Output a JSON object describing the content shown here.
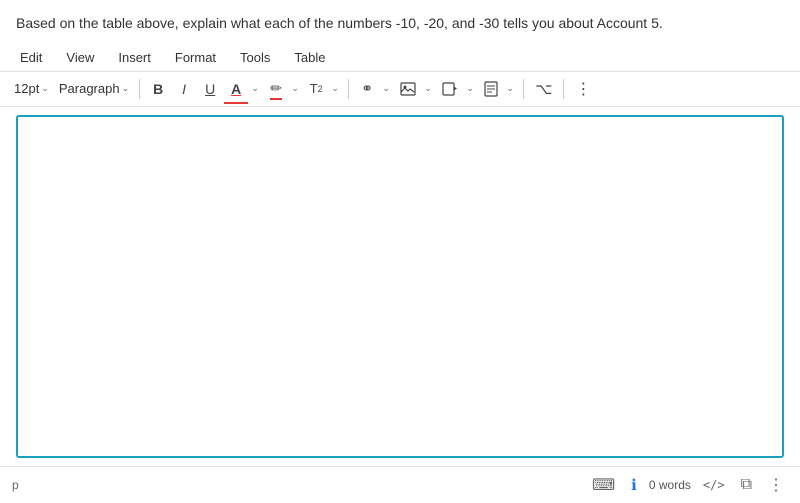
{
  "question": {
    "text": "Based on the table above, explain what each of the numbers -10, -20, and -30 tells you about Account 5."
  },
  "menu": {
    "items": [
      "Edit",
      "View",
      "Insert",
      "Format",
      "Tools",
      "Table"
    ]
  },
  "toolbar": {
    "font_size": "12pt",
    "paragraph": "Paragraph",
    "bold_label": "B",
    "italic_label": "I",
    "underline_label": "U",
    "font_color_label": "A",
    "highlight_label": "✏",
    "superscript_label": "T²",
    "link_label": "⚭",
    "image_label": "⊡",
    "media_label": "⬛",
    "doc_label": "📄",
    "special_label": "⌥",
    "more_label": "⋮"
  },
  "status": {
    "paragraph_tag": "p",
    "word_count_label": "0 words",
    "keyboard_icon": "⌨",
    "info_icon": "ℹ",
    "code_icon": "</>",
    "expand_icon": "⤢",
    "more_icon": "⋮"
  }
}
